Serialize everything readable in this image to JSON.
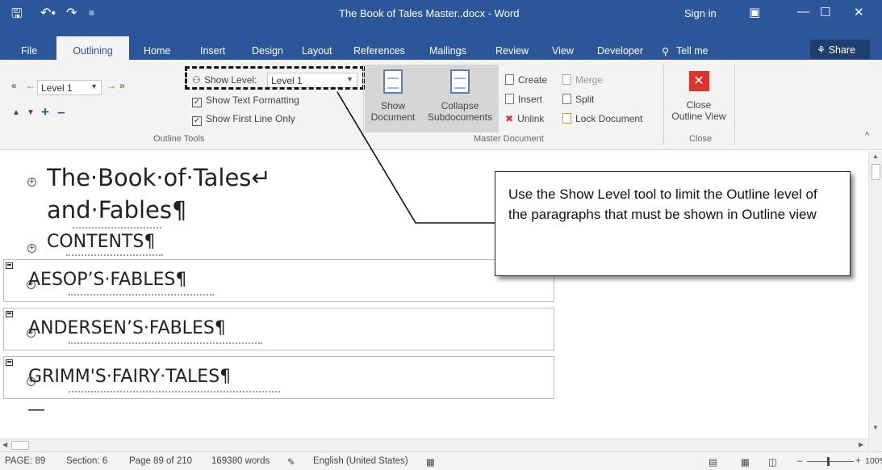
{
  "titlebar": {
    "doc_title": "The Book of Tales Master..docx - Word",
    "sign_in": "Sign in",
    "save_icon": "save-icon",
    "undo_icon": "undo-icon",
    "redo_icon": "redo-icon"
  },
  "tabs": {
    "file": "File",
    "outlining": "Outlining",
    "home": "Home",
    "insert": "Insert",
    "design": "Design",
    "layout": "Layout",
    "references": "References",
    "mailings": "Mailings",
    "review": "Review",
    "view": "View",
    "developer": "Developer",
    "tell_me": "Tell me",
    "share": "Share"
  },
  "outline_tools": {
    "level_value": "Level 1",
    "show_level_label": "Show Level:",
    "show_level_value": "Level 1",
    "show_text_formatting": "Show Text Formatting",
    "show_first_line_only": "Show First Line Only",
    "group_label": "Outline Tools"
  },
  "master_document": {
    "show_document": [
      "Show",
      "Document"
    ],
    "collapse_subdocuments": [
      "Collapse",
      "Subdocuments"
    ],
    "create": "Create",
    "insert": "Insert",
    "unlink": "Unlink",
    "merge": "Merge",
    "split": "Split",
    "lock_document": "Lock Document",
    "group_label": "Master Document"
  },
  "close_group": {
    "close_outline_view": [
      "Close",
      "Outline View"
    ],
    "group_label": "Close"
  },
  "document": {
    "title_line1": "The·Book·of·Tales↵",
    "title_line2": "and·Fables¶",
    "contents": "CONTENTS¶",
    "sub1": "AESOP’S·FABLES¶",
    "sub2": "ANDERSEN’S·FABLES¶",
    "sub3": "GRIMM'S·FAIRY·TALES¶",
    "end_mark": "—"
  },
  "callout": {
    "text": "Use the Show Level tool to limit the Outline level of the paragraphs that must be shown in Outline view"
  },
  "status": {
    "page": "PAGE: 89",
    "section": "Section: 6",
    "page_of": "Page 89 of 210",
    "words": "169380 words",
    "language": "English (United States)",
    "zoom": "100%"
  },
  "colors": {
    "word_blue": "#2b579a",
    "close_red": "#d9352b",
    "arrow_green": "#2e9e3e"
  }
}
